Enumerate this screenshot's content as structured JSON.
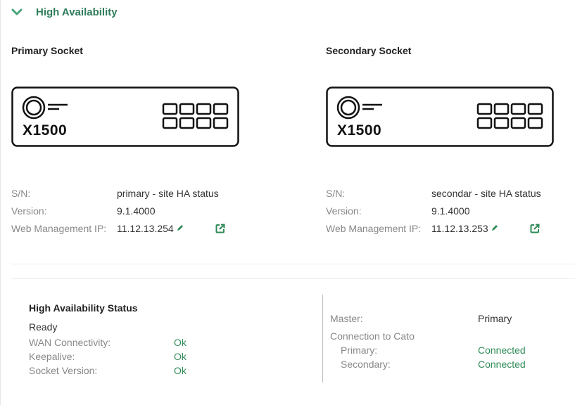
{
  "section": {
    "title": "High Availability"
  },
  "primary": {
    "title": "Primary Socket",
    "model": "X1500",
    "sn_label": "S/N:",
    "sn_value": "primary - site HA status",
    "version_label": "Version:",
    "version_value": "9.1.4000",
    "ip_label": "Web Management IP:",
    "ip_value": "11.12.13.254"
  },
  "secondary": {
    "title": "Secondary Socket",
    "model": "X1500",
    "sn_label": "S/N:",
    "sn_value": "secondar - site HA status",
    "version_label": "Version:",
    "version_value": "9.1.4000",
    "ip_label": "Web Management IP:",
    "ip_value": "11.12.13.253"
  },
  "ha_status": {
    "title": "High Availability Status",
    "state": "Ready",
    "rows": [
      {
        "label": "WAN Connectivity:",
        "value": "Ok"
      },
      {
        "label": "Keepalive:",
        "value": "Ok"
      },
      {
        "label": "Socket Version:",
        "value": "Ok"
      }
    ]
  },
  "master_info": {
    "master_label": "Master:",
    "master_value": "Primary",
    "connection_label": "Connection to Cato",
    "rows": [
      {
        "label": "Primary:",
        "value": "Connected"
      },
      {
        "label": "Secondary:",
        "value": "Connected"
      }
    ]
  },
  "colors": {
    "accent": "#2e7d5b",
    "status_ok": "#2e8b57"
  },
  "icons": [
    "chevron-down-icon",
    "edit-pencil-icon",
    "external-link-icon"
  ]
}
